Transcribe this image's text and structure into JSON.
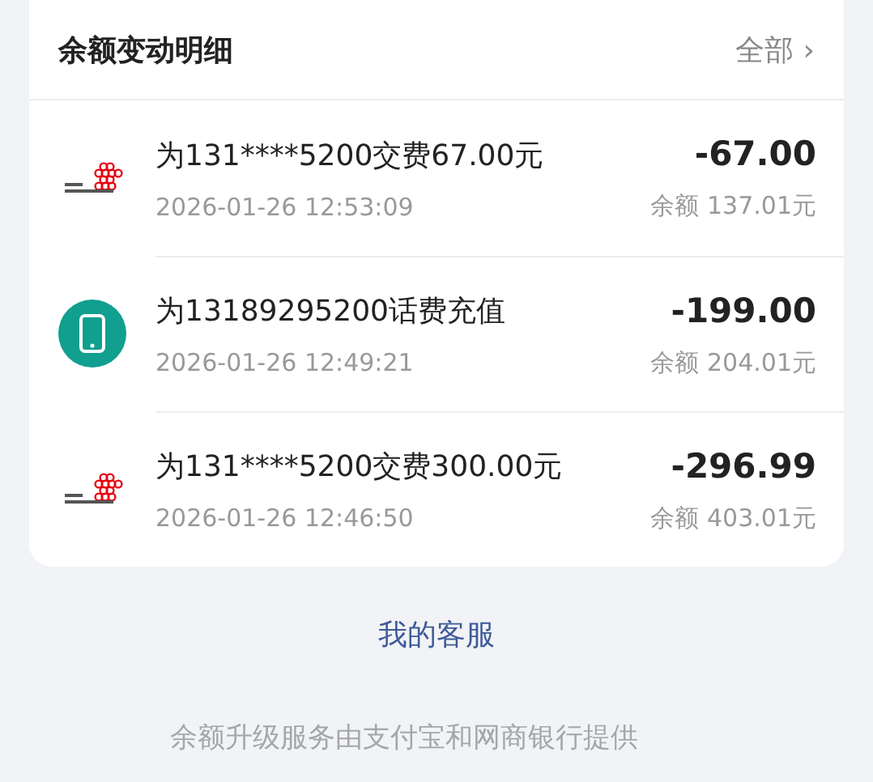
{
  "card": {
    "title": "余额变动明细",
    "filter": "全部 ›"
  },
  "transactions": [
    {
      "kind": "unicom",
      "title": "为131****5200交费67.00元",
      "time": "2026-01-26 12:53:09",
      "amount": "-67.00",
      "balance": "余额 137.01元"
    },
    {
      "kind": "phone",
      "title": "为13189295200话费充值",
      "time": "2026-01-26 12:49:21",
      "amount": "-199.00",
      "balance": "余额 204.01元"
    },
    {
      "kind": "unicom",
      "title": "为131****5200交费300.00元",
      "time": "2026-01-26 12:46:50",
      "amount": "-296.99",
      "balance": "余额 403.01元"
    }
  ],
  "service_link": "我的客服",
  "footer": "余额升级服务由支付宝和网商银行提供"
}
